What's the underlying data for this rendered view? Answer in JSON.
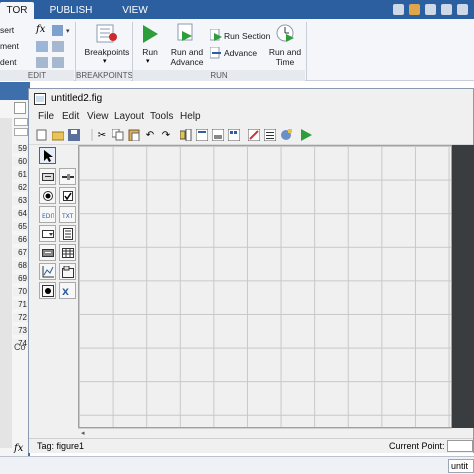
{
  "tabs": [
    {
      "label": "TOR",
      "active": true
    },
    {
      "label": "PUBLISH",
      "active": false
    },
    {
      "label": "VIEW",
      "active": false
    }
  ],
  "ribbon": {
    "edit": {
      "items": [
        "sert",
        "ment",
        "dent"
      ],
      "label": "EDIT"
    },
    "breakpoints": {
      "button_label": "Breakpoints",
      "label": "BREAKPOINTS"
    },
    "run": {
      "run_label": "Run",
      "run_advance_label1": "Run and",
      "run_advance_label2": "Advance",
      "run_section_label": "Run Section",
      "advance_label": "Advance",
      "run_time_label1": "Run and",
      "run_time_label2": "Time",
      "label": "RUN"
    }
  },
  "editor": {
    "line_numbers": [
      "59",
      "60",
      "61",
      "62",
      "63",
      "64",
      "65",
      "66",
      "67",
      "68",
      "69",
      "70",
      "71",
      "72",
      "73",
      "74"
    ],
    "left_stub": "Co",
    "fx_label": "fx"
  },
  "guide_window": {
    "title": "untitled2.fig",
    "menu": [
      "File",
      "Edit",
      "View",
      "Layout",
      "Tools",
      "Help"
    ],
    "status_tag": "Tag: figure1",
    "status_current_point": "Current Point:",
    "bottom_text": "untit"
  },
  "colors": {
    "matlab_blue": "#2b5fa0",
    "run_green": "#2e9d3a",
    "grid_line": "#c8c8c8"
  }
}
